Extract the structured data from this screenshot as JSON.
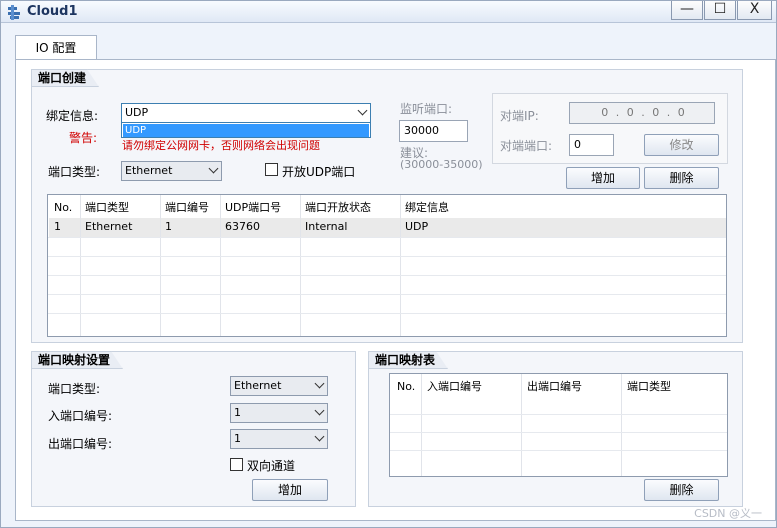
{
  "window": {
    "title": "Cloud1",
    "minimize": "—",
    "maximize": "☐",
    "close": "X"
  },
  "tabs": [
    {
      "label": "IO 配置"
    }
  ],
  "port_create": {
    "title": "端口创建",
    "binding_label": "绑定信息:",
    "binding_value": "UDP",
    "binding_options": [
      "UDP"
    ],
    "warning_label": "警告:",
    "warning_text": "请勿绑定公网网卡，否则网络会出现问题",
    "port_type_label": "端口类型:",
    "port_type_value": "Ethernet",
    "open_udp_label": "开放UDP端口",
    "listen_port_label": "监听端口:",
    "listen_port_value": "30000",
    "suggest_label": "建议:",
    "suggest_range": "(30000-35000)",
    "peer_ip_label": "对端IP:",
    "peer_ip_value": "0 . 0 . 0 . 0",
    "peer_port_label": "对端端口:",
    "peer_port_value": "0",
    "modify_button": "修改",
    "add_button": "增加",
    "delete_button": "删除",
    "table": {
      "headers": [
        "No.",
        "端口类型",
        "端口编号",
        "UDP端口号",
        "端口开放状态",
        "绑定信息"
      ],
      "rows": [
        [
          "1",
          "Ethernet",
          "1",
          "63760",
          "Internal",
          "UDP"
        ]
      ]
    }
  },
  "port_mapping_settings": {
    "title": "端口映射设置",
    "port_type_label": "端口类型:",
    "port_type_value": "Ethernet",
    "in_port_label": "入端口编号:",
    "in_port_value": "1",
    "out_port_label": "出端口编号:",
    "out_port_value": "1",
    "bidirectional_label": "双向通道",
    "add_button": "增加"
  },
  "port_mapping_table": {
    "title": "端口映射表",
    "headers": [
      "No.",
      "入端口编号",
      "出端口编号",
      "端口类型"
    ],
    "delete_button": "删除"
  },
  "watermark": "CSDN @义一"
}
